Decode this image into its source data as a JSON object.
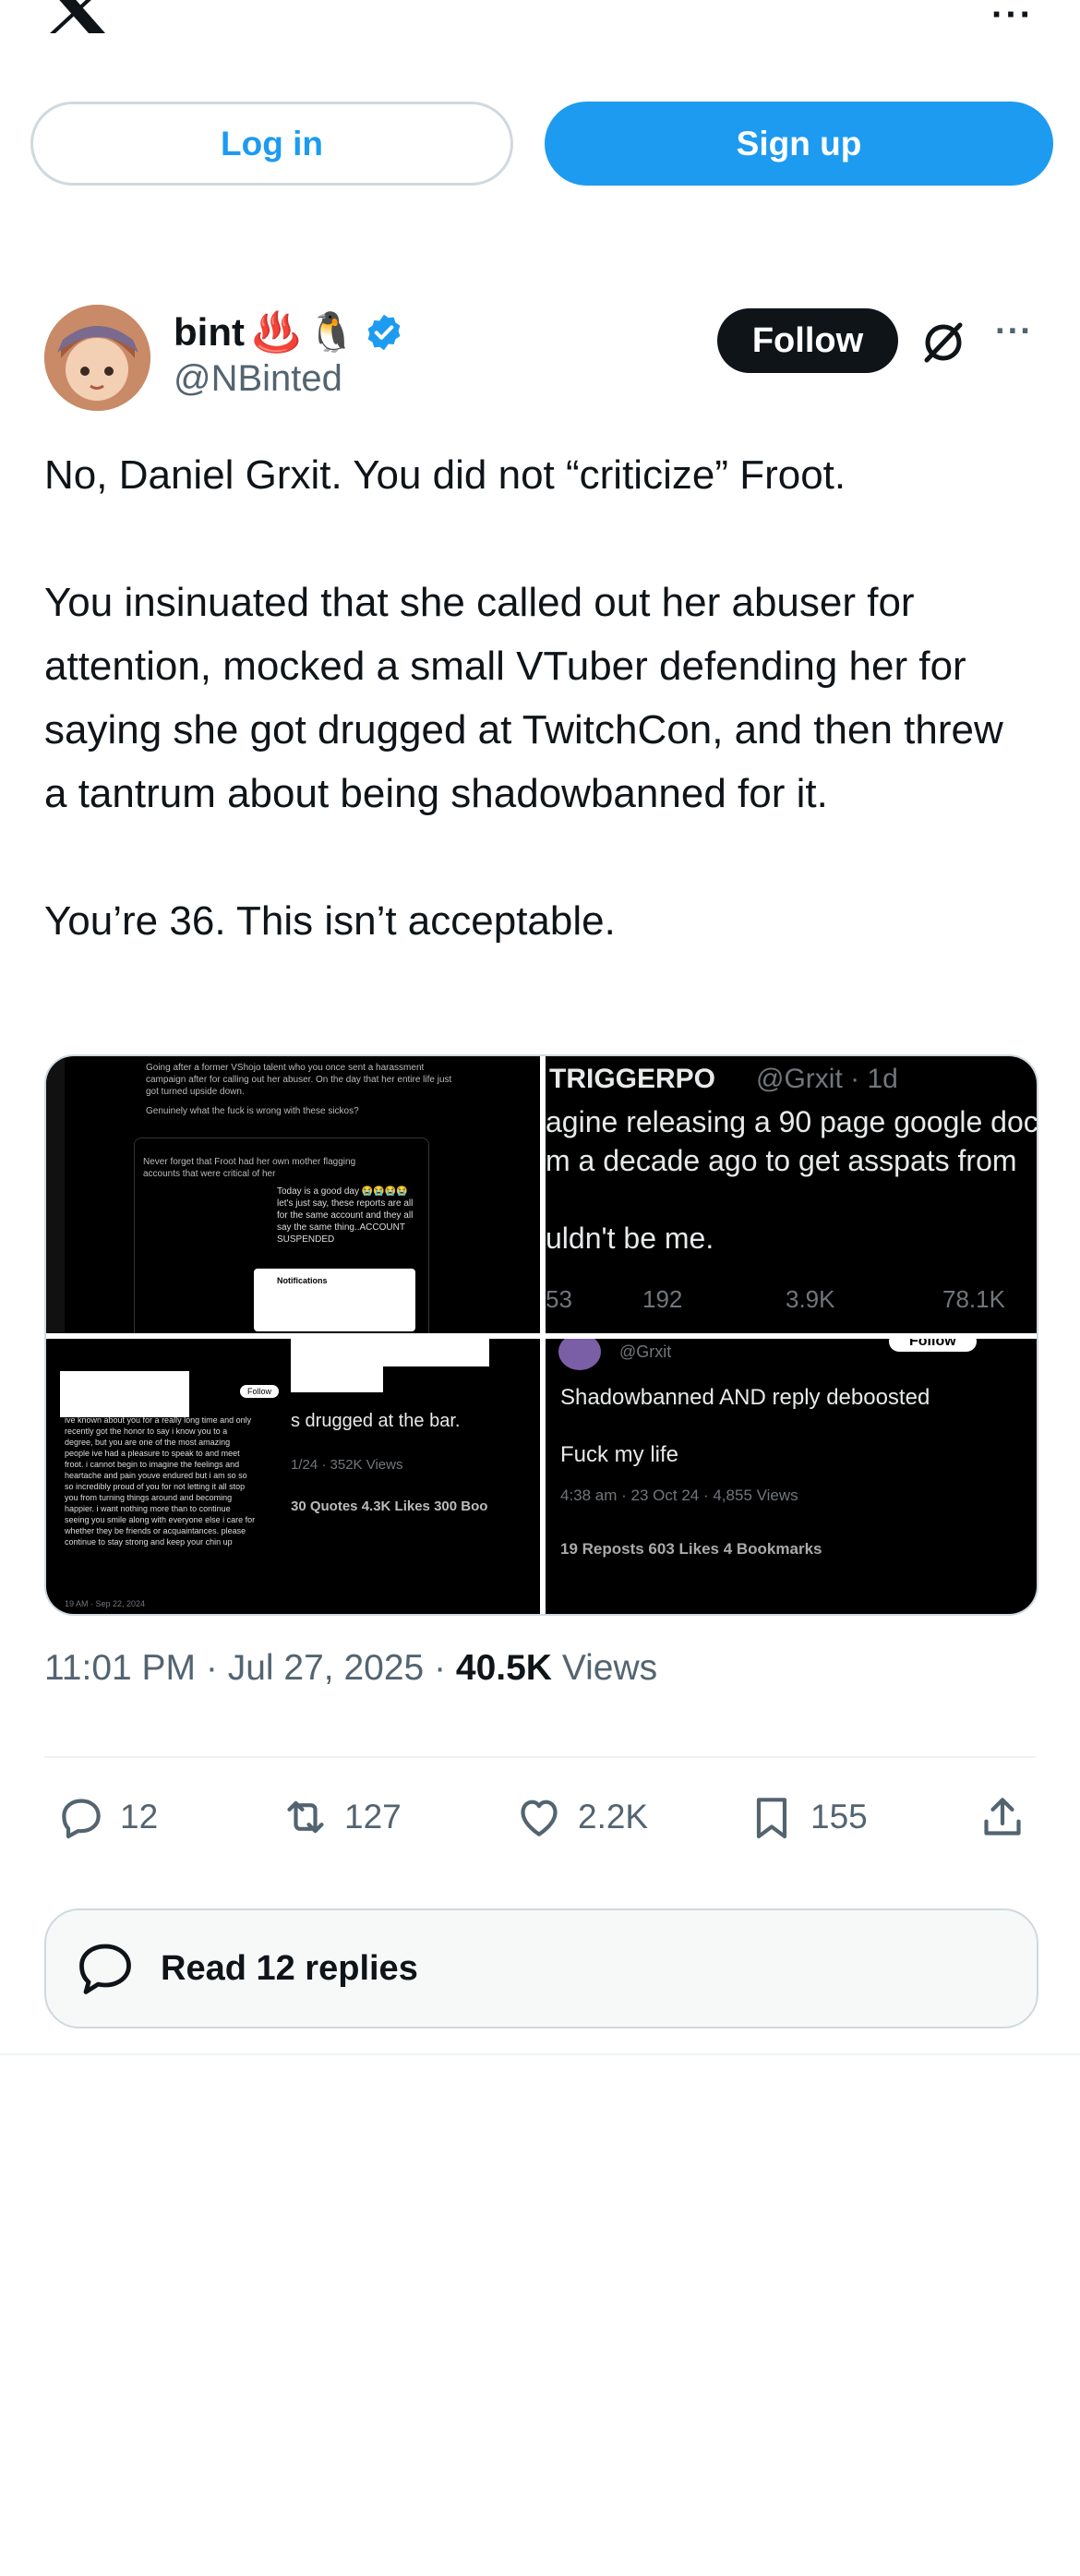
{
  "topbar": {
    "logo": "x-logo",
    "more": "···"
  },
  "auth": {
    "login_label": "Log in",
    "signup_label": "Sign up"
  },
  "tweet": {
    "display_name": "bint",
    "name_emojis": [
      "♨️",
      "🐧"
    ],
    "handle": "@NBinted",
    "follow_label": "Follow",
    "more": "···",
    "text_paragraphs": [
      "No, Daniel Grxit. You did not “criticize” Froot.",
      "You insinuated that she called out her abuser for attention, mocked a small VTuber defending her for saying she got drugged at TwitchCon, and then threw a tantrum about being shadowbanned for it.",
      "You’re 36. This isn’t acceptable."
    ],
    "time": "11:01 PM",
    "date": "Jul 27, 2025",
    "views_count": "40.5K",
    "views_label": "Views",
    "accent_color": "#1d9bf0"
  },
  "media": {
    "img1": {
      "lines": [
        "Going after a former VShojo talent who you once sent a harassment",
        "campaign after for calling out her abuser. On the day that her entire life just",
        "got turned upside down.",
        "Genuinely what the fuck is wrong with these sickos?"
      ],
      "quoted": "Never forget that Froot had her own mother flagging accounts that were critical of her",
      "nested": "Today is a good day 😭😭😭😭 let's just say, these reports are all for the same account and they all say the same thing..ACCOUNT SUSPENDED",
      "notif_title": "Notifications"
    },
    "img2": {
      "name": "TRIGGERPO",
      "handle_time": "@Grxit · 1d",
      "lines": [
        "agine releasing a 90 page google doc",
        "m a decade ago to get asspats from",
        "uldn't be me."
      ],
      "stats": [
        "53",
        "192",
        "3.9K",
        "78.1K"
      ]
    },
    "img3": {
      "lines": [
        "ive known about you for a really long time and only",
        "recently got the honor to say i know you to a",
        "degree, but you are one of the most amazing",
        "people ive had a pleasure to speak to and meet",
        "froot. i cannot begin to imagine the feelings and",
        "heartache and pain youve endured but i am so so",
        "so incredibly proud of you for not letting it all stop",
        "you from turning things around and becoming",
        "happier. i want nothing more than to continue",
        "seeing you smile along with everyone else i care for",
        "whether they be friends or acquaintances. please",
        "continue to stay strong and keep your chin up"
      ],
      "timestamp": "19 AM · Sep 22, 2024",
      "right_text": "s drugged at the bar.",
      "views": "1/24 · 352K Views",
      "quotes": "30 Quotes  4.3K Likes  300 Boo",
      "follow": "Follow"
    },
    "img4": {
      "handle": "@Grxit",
      "follow": "Follow",
      "line1": "Shadowbanned AND reply deboosted",
      "line2": "Fuck my life",
      "time": "4:38 am · 23 Oct 24 · 4,855 Views",
      "stats": "19 Reposts   603 Likes   4 Bookmarks"
    }
  },
  "actions": {
    "replies": "12",
    "reposts": "127",
    "likes": "2.2K",
    "bookmarks": "155"
  },
  "read_replies_label": "Read 12 replies"
}
